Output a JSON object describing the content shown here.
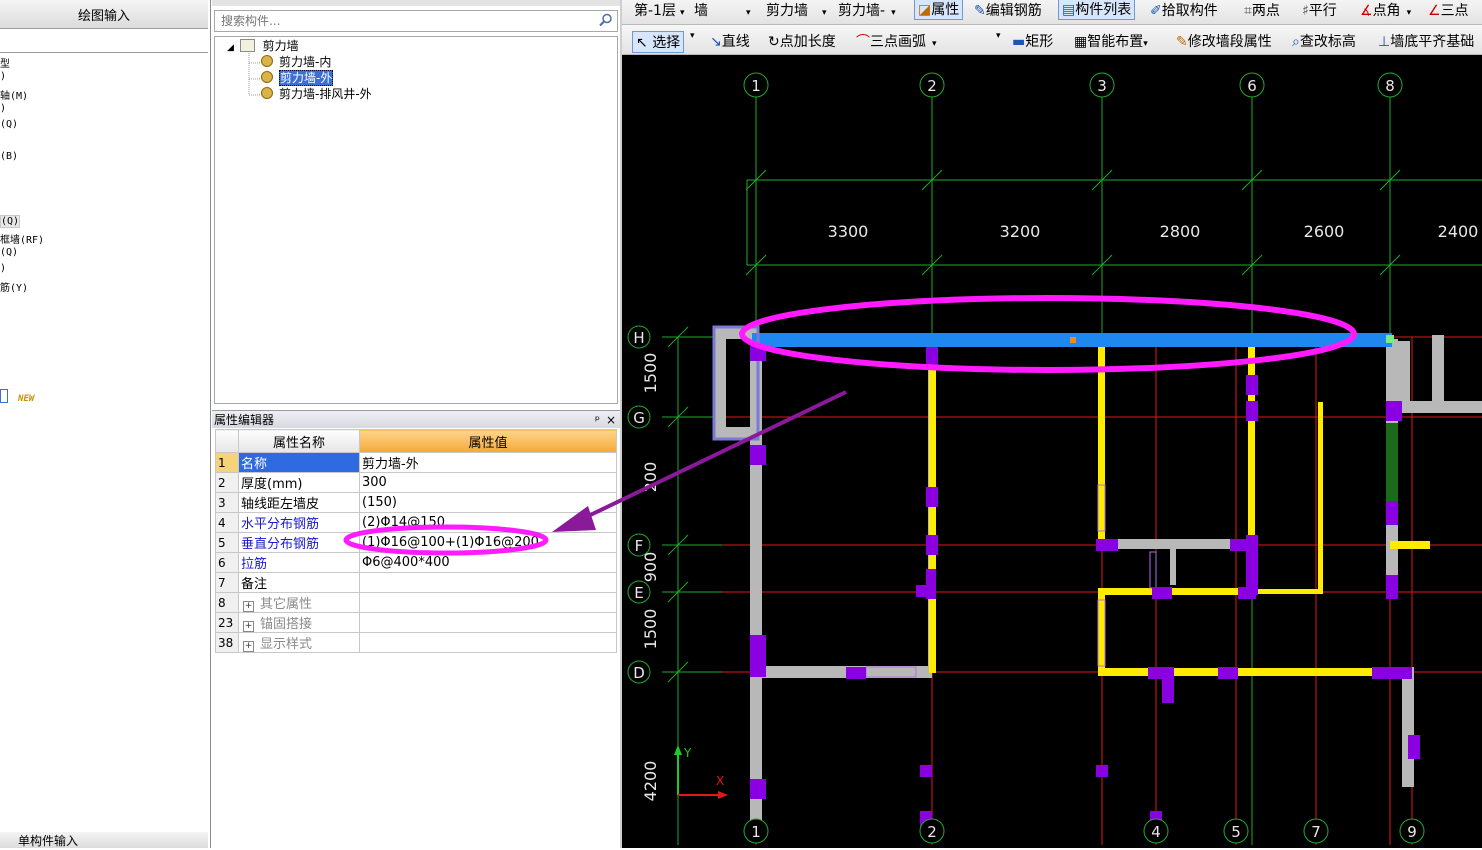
{
  "left_panel": {
    "header": "绘图输入",
    "items": [
      "型",
      ")",
      "轴(M)",
      ")",
      "(Q)",
      "(B)",
      "(Q)",
      "框墙(RF)",
      "(Q)",
      ")",
      "筋(Y)"
    ],
    "new_badge": "NEW",
    "footer": "单构件输入"
  },
  "component_panel": {
    "search_placeholder": "搜索构件...",
    "tree": {
      "root": "剪力墙",
      "children": [
        "剪力墙-内",
        "剪力墙-外",
        "剪力墙-排风井-外"
      ],
      "selected": "剪力墙-外"
    }
  },
  "property_editor": {
    "title": "属性编辑器",
    "pin": "ᵖ",
    "close": "×",
    "col_name": "属性名称",
    "col_value": "属性值",
    "rows": [
      {
        "no": "1",
        "name": "名称",
        "value": "剪力墙-外"
      },
      {
        "no": "2",
        "name": "厚度(mm)",
        "value": "300"
      },
      {
        "no": "3",
        "name": "轴线距左墙皮",
        "value": "(150)"
      },
      {
        "no": "4",
        "name": "水平分布钢筋",
        "value": "(2)Φ14@150"
      },
      {
        "no": "5",
        "name": "垂直分布钢筋",
        "value": "(1)Φ16@100+(1)Φ16@200"
      },
      {
        "no": "6",
        "name": "拉筋",
        "value": "Φ6@400*400"
      },
      {
        "no": "7",
        "name": "备注",
        "value": ""
      },
      {
        "no": "8",
        "name": "其它属性",
        "value": ""
      },
      {
        "no": "23",
        "name": "锚固搭接",
        "value": ""
      },
      {
        "no": "38",
        "name": "显示样式",
        "value": ""
      }
    ]
  },
  "toolbar1": {
    "floor": "第-1层",
    "type": "墙",
    "category": "剪力墙",
    "component": "剪力墙-",
    "properties": "属性",
    "edit_rebar": "编辑钢筋",
    "component_list": "构件列表",
    "pick_component": "拾取构件",
    "two_points": "两点",
    "parallel": "平行",
    "point_angle": "点角",
    "three_points": "三点"
  },
  "toolbar2": {
    "select": "选择",
    "line": "直线",
    "point_length": "点加长度",
    "three_point_arc": "三点画弧",
    "rectangle": "矩形",
    "smart_layout": "智能布置",
    "modify_segment": "修改墙段属性",
    "check_elevation": "查改标高",
    "align_bottom": "墙底平齐基础"
  },
  "drawing": {
    "top_axes": [
      "1",
      "2",
      "3",
      "6",
      "8"
    ],
    "bottom_axes": [
      "1",
      "2",
      "4",
      "5",
      "7",
      "9"
    ],
    "row_axes": [
      "H",
      "G",
      "F",
      "E",
      "D"
    ],
    "spans": [
      "3300",
      "3200",
      "2800",
      "2600",
      "2400"
    ],
    "row_dims": [
      "1500",
      "200",
      "900",
      "1500",
      "4200"
    ],
    "axis_y": "Y",
    "axis_x": "X",
    "colors": {
      "wall_selected": "#1e88f0",
      "wall_yellow": "#ffeb00",
      "column": "#8a00e0",
      "wall_gray": "#b8b8b8",
      "grid_green": "#1faa2a",
      "grid_red": "#e01818",
      "highlight": "#ff1aff"
    }
  }
}
